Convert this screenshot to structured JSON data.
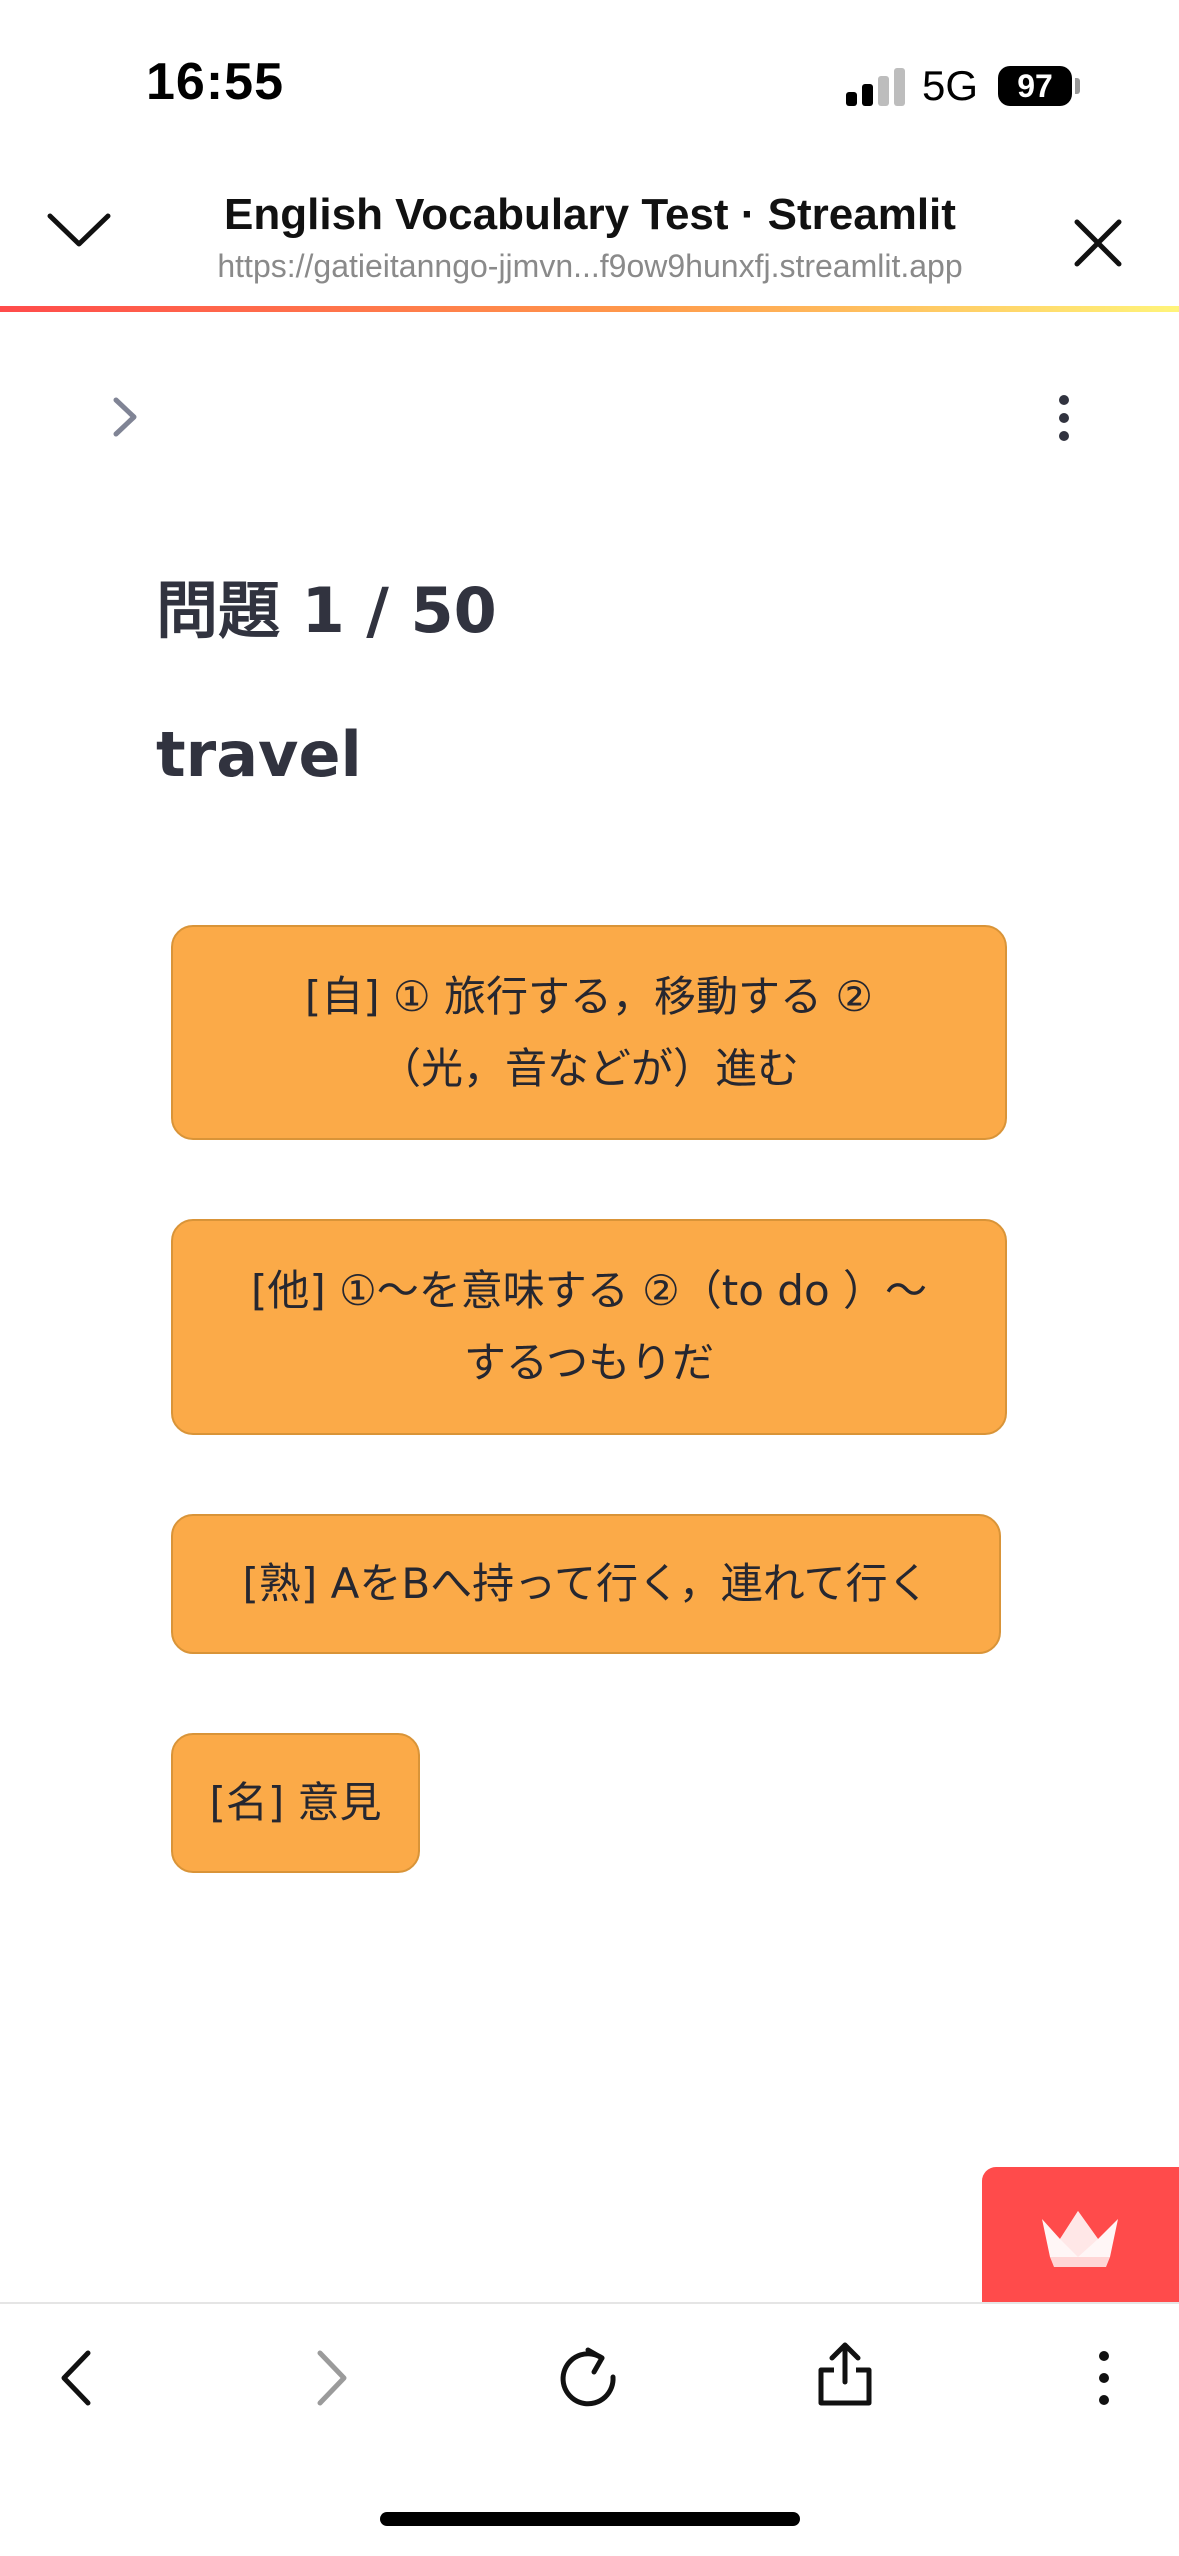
{
  "status_bar": {
    "time": "16:55",
    "network": "5G",
    "battery": "97"
  },
  "browser_header": {
    "title": "English Vocabulary Test · Streamlit",
    "url": "https://gatieitanngo-jjmvn...f9ow9hunxfj.streamlit.app"
  },
  "quiz": {
    "question_header": "問題 1 / 50",
    "word": "travel",
    "choices": [
      {
        "line1": "[自] ① 旅行する，移動する ②",
        "line2": "（光，音などが）進む"
      },
      {
        "line1": "[他] ①～を意味する ②（to do ）～",
        "line2": "するつもりだ"
      },
      {
        "line1": "[熟] AをBへ持って行く，連れて行く",
        "line2": ""
      },
      {
        "line1": "[名] 意見",
        "line2": ""
      }
    ]
  },
  "colors": {
    "accent": "#ff4b4b",
    "choice_bg": "#fbaa48",
    "text": "#31333f"
  },
  "icons": {
    "collapse": "chevron-down-icon",
    "close": "close-icon",
    "sidebar": "chevron-right-icon",
    "menu": "more-vertical-icon",
    "back": "back-icon",
    "forward": "forward-icon",
    "reload": "reload-icon",
    "share": "share-icon",
    "more": "more-vertical-icon",
    "streamlit": "streamlit-crown-icon"
  }
}
